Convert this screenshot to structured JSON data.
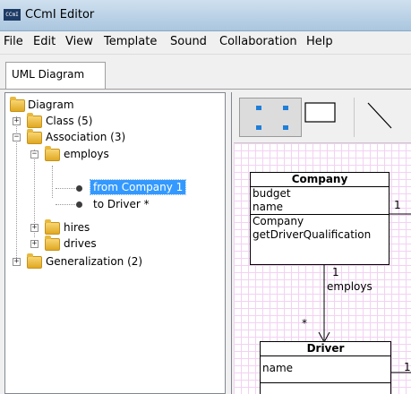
{
  "window": {
    "app_icon_text": "CCmI",
    "title": "CCmI Editor"
  },
  "menu": [
    "File",
    "Edit",
    "View",
    "Template",
    "Sound",
    "Collaboration",
    "Help"
  ],
  "tabs": [
    {
      "label": "UML Diagram",
      "active": true
    }
  ],
  "tree": {
    "root": "Diagram",
    "class_folder": "Class (5)",
    "association_folder": "Association (3)",
    "employs": "employs",
    "employs_from": "from Company 1",
    "employs_to": "to Driver *",
    "hires": "hires",
    "drives": "drives",
    "generalization_folder": "Generalization (2)"
  },
  "palette": {
    "tools": [
      "selection-tool",
      "class-tool",
      "association-tool"
    ]
  },
  "diagram": {
    "company": {
      "name": "Company",
      "attributes": [
        "budget",
        "name"
      ],
      "operations": [
        "Company",
        "getDriverQualification"
      ]
    },
    "driver": {
      "name": "Driver",
      "attributes": [
        "name"
      ]
    },
    "association": {
      "name": "employs",
      "source_multiplicity": "1",
      "target_multiplicity": "*"
    },
    "right_multiplicity_top": "1",
    "right_multiplicity_bottom": "1"
  },
  "colors": {
    "selection": "#3399ff",
    "grid_line": "#f3d2f3",
    "folder": "#e8b93e",
    "titlebar": "#bcd4ea"
  }
}
